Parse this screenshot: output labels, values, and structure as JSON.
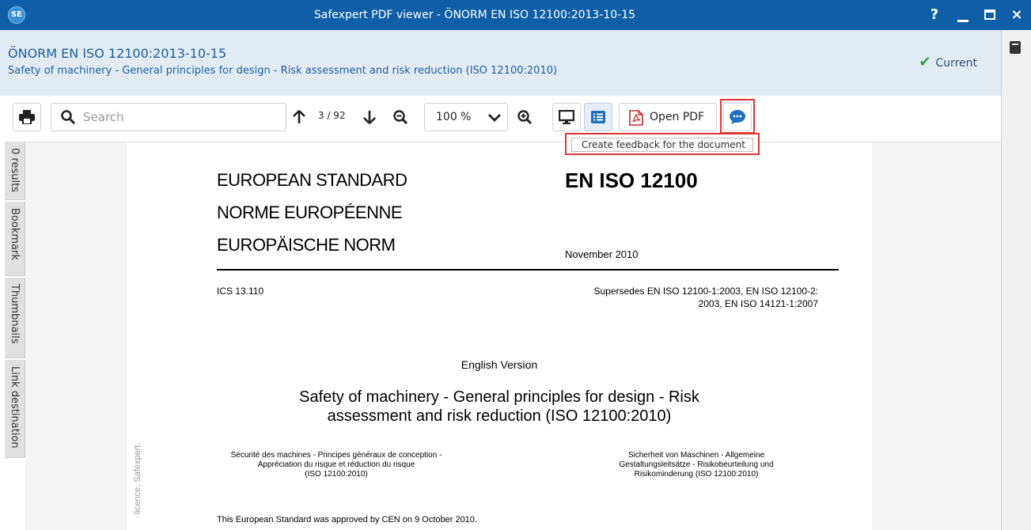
{
  "window": {
    "title": "Safexpert PDF viewer - ÖNORM EN ISO 12100:2013-10-15",
    "logo_text": "SE",
    "controls": {
      "help": "?",
      "minimize": "_",
      "close": "×"
    }
  },
  "header": {
    "title": "ÖNORM EN ISO 12100:2013-10-15",
    "subtitle": "Safety of machinery - General principles for design - Risk assessment and risk reduction (ISO 12100:2010)",
    "status": "Current"
  },
  "toolbar": {
    "search_placeholder": "Search",
    "page_indicator": "3 / 92",
    "zoom": "100 %",
    "open_pdf_label": "Open PDF",
    "tooltip": "Create feedback for the document"
  },
  "side_tabs": [
    {
      "label": "0 results"
    },
    {
      "label": "Bookmark"
    },
    {
      "label": "Thumbnails"
    },
    {
      "label": "Link destination"
    }
  ],
  "document": {
    "header_lines": [
      "EUROPEAN STANDARD",
      "NORME EUROPÉENNE",
      "EUROPÄISCHE NORM"
    ],
    "standard_number": "EN ISO 12100",
    "date": "November 2010",
    "ics": "ICS 13.110",
    "supersedes_line1": "Supersedes EN ISO 12100-1:2003, EN ISO 12100-2:",
    "supersedes_line2": "2003, EN ISO 14121-1:2007",
    "version": "English Version",
    "main_title_line1": "Safety of machinery - General principles for design - Risk",
    "main_title_line2": "assessment and risk reduction (ISO 12100:2010)",
    "french_title": [
      "Sécurité des machines - Principes généraux de conception -",
      "Appréciation du risque et réduction du risque",
      "(ISO 12100:2010)"
    ],
    "german_title": [
      "Sicherheit von Maschinen - Allgemeine",
      "Gestaltungsleitsätze - Risikobeurteilung und",
      "Risikominderung (ISO 12100:2010)"
    ],
    "approval": "This European Standard was approved by CEN on 9 October 2010.",
    "watermark": "licence, Safexpert."
  }
}
